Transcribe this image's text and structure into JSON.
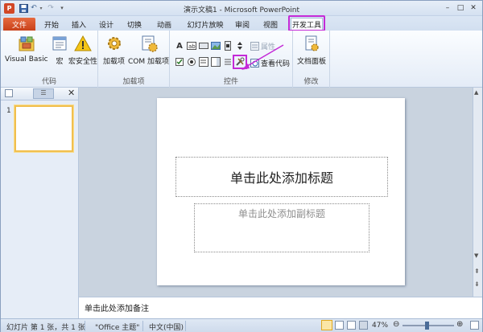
{
  "window": {
    "title": "演示文稿1 - Microsoft PowerPoint",
    "app_icon_letter": "P",
    "quick_access": [
      "save-icon",
      "undo-icon",
      "redo-icon",
      "customize-icon"
    ]
  },
  "tabs": [
    "文件",
    "开始",
    "插入",
    "设计",
    "切换",
    "动画",
    "幻灯片放映",
    "审阅",
    "视图",
    "开发工具"
  ],
  "active_tab": "开发工具",
  "ribbon": {
    "groups": [
      {
        "label": "代码",
        "buttons": [
          "Visual Basic",
          "宏",
          "宏安全性"
        ]
      },
      {
        "label": "加载项",
        "buttons": [
          "加载项",
          "COM 加载项"
        ]
      },
      {
        "label": "控件",
        "buttons": [
          "属性",
          "查看代码"
        ]
      },
      {
        "label": "修改",
        "buttons": [
          "文档面板"
        ]
      }
    ]
  },
  "left_pane": {
    "slide_number": "1"
  },
  "slide": {
    "title_placeholder": "单击此处添加标题",
    "subtitle_placeholder": "单击此处添加副标题"
  },
  "notes": {
    "placeholder": "单击此处添加备注"
  },
  "status": {
    "slide_info": "幻灯片 第 1 张，共 1 张",
    "theme": "\"Office 主题\"",
    "language": "中文(中国)",
    "zoom": "47%"
  },
  "colors": {
    "accent_highlight": "#c42ad7",
    "file_tab": "#d24726",
    "selection": "#f0bf4f"
  }
}
